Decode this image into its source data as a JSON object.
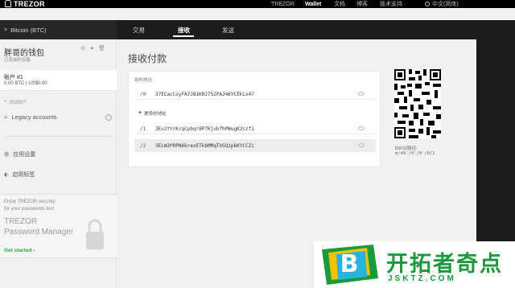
{
  "header": {
    "brand": "TREZOR",
    "nav": [
      "TREZOR",
      "Wallet",
      "文档",
      "博客",
      "技术支持"
    ],
    "active_nav": "Wallet",
    "language": "中文(简体)"
  },
  "coin_bar": {
    "coin": "Bitcoin (BTC)",
    "tabs": [
      "交易",
      "接收",
      "发送"
    ],
    "active_tab": "接收"
  },
  "sidebar": {
    "wallet_name": "胖哥的钱包",
    "wallet_status": "已连接的设备",
    "account_title": "账户 #1",
    "account_balance": "0.00 BTC | US$0.00",
    "add_account": "添加账户",
    "legacy_accounts": "Legacy accounts",
    "settings": "应用设置",
    "labeling": "启用标签",
    "promo_line1": "Enjoy TREZOR security",
    "promo_line2": "for your passwords too!",
    "promo_brand1": "TREZOR",
    "promo_brand2": "Password Manager",
    "promo_cta": "Get started"
  },
  "main": {
    "title": "接收付款",
    "fresh_label": "新的地址",
    "addresses": [
      {
        "path": "/0",
        "address": "37ECacCoyFA7JB1KR2752PAJ46YCEkLx47"
      },
      {
        "path": "/1",
        "address": "3Eu2tYrKrqCpbqr8P7KjuhfhPWugK2czf1"
      },
      {
        "path": "/2",
        "address": "3ELW2PRPN6brexETkbMMqTXGQzp6KYCCZi"
      }
    ],
    "more_label": "更多的地址",
    "bip_label": "BIP32路径:",
    "bip_path": "m/49'/0'/0'/0/2"
  },
  "watermark": {
    "letter": "B",
    "text": "开拓者奇点",
    "url": "JSKTZ.COM"
  },
  "colors": {
    "header_bg": "#000000",
    "subbar_bg": "#1c1c1c",
    "accent_green": "#1a9a3a"
  }
}
